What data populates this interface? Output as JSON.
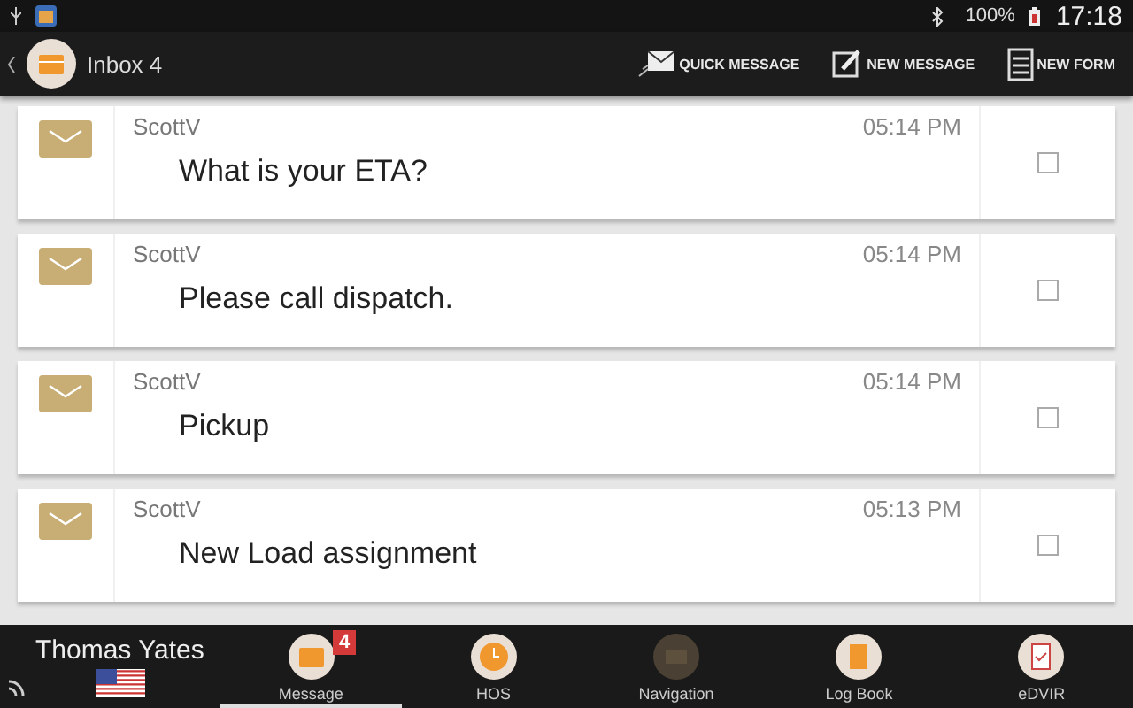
{
  "status_bar": {
    "battery": "100%",
    "time": "17:18"
  },
  "app_bar": {
    "title": "Inbox 4",
    "actions": [
      {
        "kind": "quick",
        "label": "QUICK MESSAGE"
      },
      {
        "kind": "new",
        "label": "NEW MESSAGE"
      },
      {
        "kind": "form",
        "label": "NEW FORM"
      }
    ]
  },
  "messages": [
    {
      "sender": "ScottV",
      "time": "05:14 PM",
      "text": "What is your ETA?",
      "checked": false
    },
    {
      "sender": "ScottV",
      "time": "05:14 PM",
      "text": "Please call dispatch.",
      "checked": false
    },
    {
      "sender": "ScottV",
      "time": "05:14 PM",
      "text": "Pickup",
      "checked": false
    },
    {
      "sender": "ScottV",
      "time": "05:13 PM",
      "text": "New Load assignment",
      "checked": false
    }
  ],
  "driver": {
    "name": "Thomas Yates"
  },
  "nav": [
    {
      "kind": "message",
      "label": "Message",
      "badge": "4",
      "selected": true,
      "disabled": false
    },
    {
      "kind": "hos",
      "label": "HOS",
      "selected": false,
      "disabled": false
    },
    {
      "kind": "navigation",
      "label": "Navigation",
      "selected": false,
      "disabled": true
    },
    {
      "kind": "logbook",
      "label": "Log Book",
      "selected": false,
      "disabled": false
    },
    {
      "kind": "edvir",
      "label": "eDVIR",
      "selected": false,
      "disabled": false
    }
  ]
}
